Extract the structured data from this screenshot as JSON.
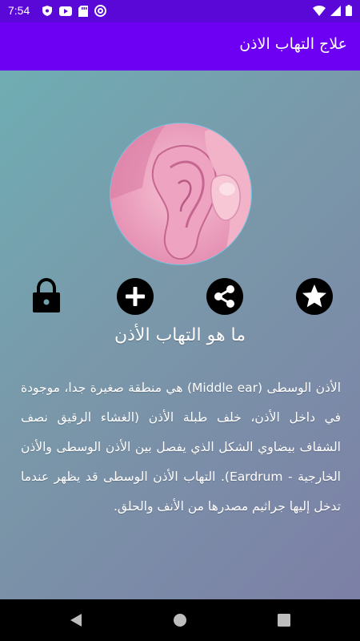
{
  "status_bar": {
    "time": "7:54",
    "left_icons": [
      "shield-icon",
      "youtube-icon",
      "sd-card-icon",
      "at-sign-icon"
    ],
    "right_icons": [
      "wifi-icon",
      "signal-icon",
      "battery-icon"
    ]
  },
  "app_bar": {
    "title": "علاج التهاب الاذن",
    "color": "#6d00f2"
  },
  "actions": {
    "icons": [
      "lock-icon",
      "add-icon",
      "share-icon",
      "star-icon"
    ]
  },
  "article": {
    "heading": "ما هو التهاب الأذن",
    "body": "الأذن الوسطى (Middle ear) هي منطقة صغيرة جدا، موجودة في داخل الأذن، خلف طبلة الأذن (الغشاء الرقيق نصف الشفاف بيضاوي الشكل الذي يفصل بين الأذن الوسطى والأذن الخارجية - Eardrum). التهاب الأذن الوسطى قد يظهر عندما تدخل إليها جراثيم مصدرها من الأنف والحلق."
  },
  "nav_bar": {
    "icons": [
      "back-icon",
      "home-icon",
      "recents-icon"
    ]
  }
}
